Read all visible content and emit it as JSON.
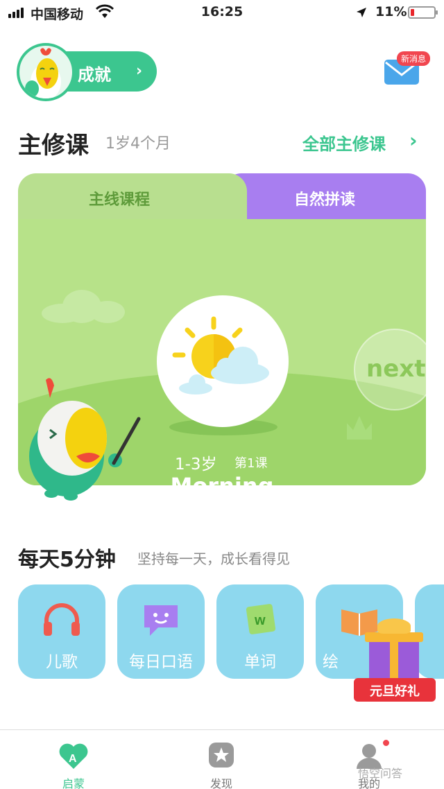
{
  "status_bar": {
    "carrier": "中国移动",
    "time": "16:25",
    "battery": "11%"
  },
  "header": {
    "achievement_label": "成就",
    "mail_badge": "新消息"
  },
  "main_course": {
    "title": "主修课",
    "age": "1岁4个月",
    "all_link": "全部主修课",
    "tabs": [
      {
        "label": "主线课程",
        "active": true
      },
      {
        "label": "自然拼读",
        "active": false
      }
    ],
    "next_label": "next",
    "lesson": {
      "age_range": "1-3岁",
      "number": "第1课",
      "title": "Morning"
    }
  },
  "daily": {
    "title": "每天5分钟",
    "subtitle": "坚持每一天，成长看得见",
    "items": [
      {
        "label": "儿歌",
        "icon": "headphones-icon"
      },
      {
        "label": "每日口语",
        "icon": "chat-bubble-icon"
      },
      {
        "label": "单词",
        "icon": "word-card-icon"
      },
      {
        "label": "绘",
        "icon": "book-icon"
      }
    ],
    "promo_label": "元旦好礼"
  },
  "tabbar": {
    "items": [
      {
        "label": "启蒙",
        "icon": "heart-a-icon",
        "active": true
      },
      {
        "label": "发现",
        "icon": "star-icon",
        "active": false
      },
      {
        "label": "我的",
        "icon": "profile-icon",
        "active": false
      }
    ]
  },
  "watermark": "悟空问答",
  "colors": {
    "brand_green": "#3cc68f",
    "card_green": "#9ed56a",
    "tab_purple": "#a87ef0",
    "activity_blue": "#8ed8ee",
    "badge_red": "#f1464f"
  }
}
